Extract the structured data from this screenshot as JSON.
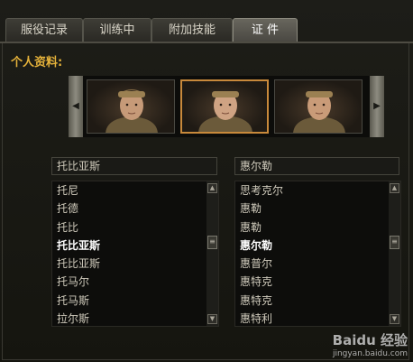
{
  "tabs": [
    {
      "label": "服役记录"
    },
    {
      "label": "训练中"
    },
    {
      "label": "附加技能"
    },
    {
      "label": "证 件"
    }
  ],
  "section_label": "个人资料:",
  "portraits": [
    {
      "name": "portrait-1",
      "selected": false
    },
    {
      "name": "portrait-2",
      "selected": true
    },
    {
      "name": "portrait-3",
      "selected": false
    }
  ],
  "first_name": {
    "value": "托比亚斯",
    "items": [
      "托尼",
      "托德",
      "托比",
      "托比亚斯",
      "托比亚斯",
      "托马尔",
      "托马斯",
      "拉尔斯"
    ],
    "selected_index": 3
  },
  "last_name": {
    "value": "惠尔勒",
    "items": [
      "思考克尔",
      "惠勒",
      "惠勒",
      "惠尔勒",
      "惠普尔",
      "惠特克",
      "惠特克",
      "惠特利"
    ],
    "selected_index": 3
  },
  "watermark": {
    "brand": "Baidu 经验",
    "url": "jingyan.baidu.com"
  },
  "colors": {
    "accent": "#e5b23a",
    "selected_border": "#c8893b"
  }
}
